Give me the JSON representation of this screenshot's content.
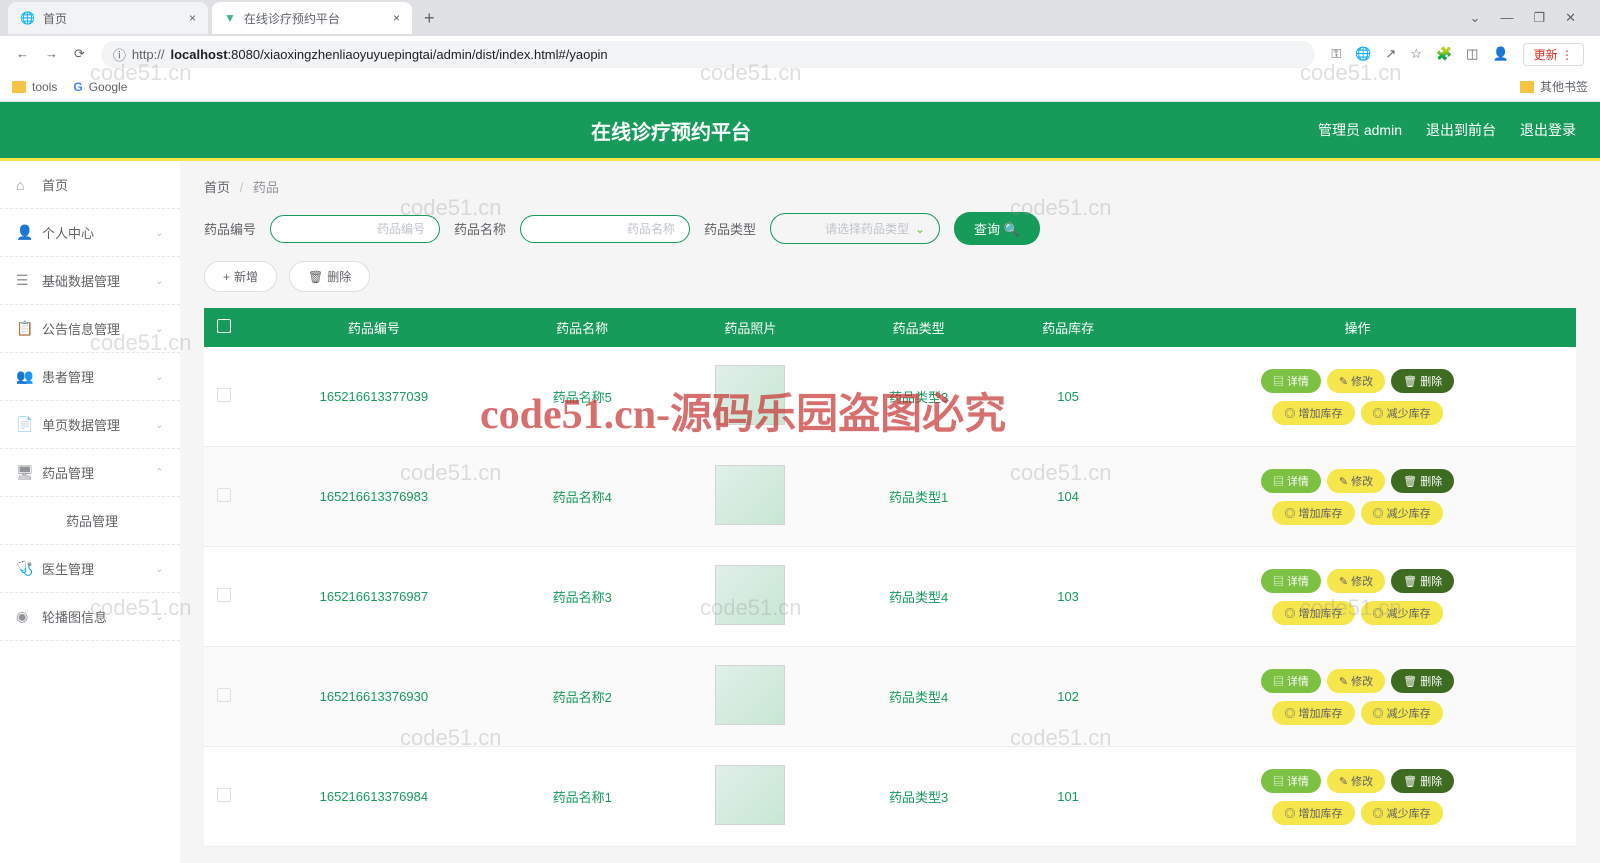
{
  "browser": {
    "tabs": [
      {
        "label": "首页"
      },
      {
        "label": "在线诊疗预约平台"
      }
    ],
    "url_prefix": "http://",
    "url_host": "localhost",
    "url_rest": ":8080/xiaoxingzhenliaoyuyuepingtai/admin/dist/index.html#/yaopin",
    "update_label": "更新",
    "bookmarks": [
      {
        "label": "tools"
      },
      {
        "label": "Google"
      }
    ],
    "other_bookmarks": "其他书签"
  },
  "header": {
    "title": "在线诊疗预约平台",
    "admin": "管理员 admin",
    "logout_front": "退出到前台",
    "logout": "退出登录"
  },
  "sidebar": {
    "items": [
      {
        "icon": "⌂",
        "label": "首页",
        "expandable": false
      },
      {
        "icon": "👤",
        "label": "个人中心",
        "expandable": true,
        "arrow": "⌄"
      },
      {
        "icon": "☰",
        "label": "基础数据管理",
        "expandable": true,
        "arrow": "⌄"
      },
      {
        "icon": "📋",
        "label": "公告信息管理",
        "expandable": true,
        "arrow": "⌄"
      },
      {
        "icon": "👥",
        "label": "患者管理",
        "expandable": true,
        "arrow": "⌄"
      },
      {
        "icon": "📄",
        "label": "单页数据管理",
        "expandable": true,
        "arrow": "⌄"
      },
      {
        "icon": "🖥",
        "label": "药品管理",
        "expandable": true,
        "arrow": "⌃"
      },
      {
        "icon": "",
        "label": "药品管理",
        "expandable": false,
        "sub": true
      },
      {
        "icon": "🩺",
        "label": "医生管理",
        "expandable": true,
        "arrow": "⌄"
      },
      {
        "icon": "◉",
        "label": "轮播图信息",
        "expandable": true,
        "arrow": "⌄"
      }
    ]
  },
  "breadcrumb": {
    "home": "首页",
    "current": "药品"
  },
  "filters": {
    "id_label": "药品编号",
    "id_placeholder": "药品编号",
    "name_label": "药品名称",
    "name_placeholder": "药品名称",
    "type_label": "药品类型",
    "type_placeholder": "请选择药品类型",
    "query": "查询"
  },
  "actions": {
    "add": "新增",
    "delete": "删除"
  },
  "table": {
    "headers": [
      "药品编号",
      "药品名称",
      "药品照片",
      "药品类型",
      "药品库存",
      "操作"
    ],
    "rows": [
      {
        "id": "165216613377039",
        "name": "药品名称5",
        "type": "药品类型3",
        "stock": "105"
      },
      {
        "id": "165216613376983",
        "name": "药品名称4",
        "type": "药品类型1",
        "stock": "104"
      },
      {
        "id": "165216613376987",
        "name": "药品名称3",
        "type": "药品类型4",
        "stock": "103"
      },
      {
        "id": "165216613376930",
        "name": "药品名称2",
        "type": "药品类型4",
        "stock": "102"
      },
      {
        "id": "165216613376984",
        "name": "药品名称1",
        "type": "药品类型3",
        "stock": "101"
      }
    ],
    "ops": {
      "detail": "详情",
      "edit": "修改",
      "delete": "删除",
      "inc": "增加库存",
      "dec": "减少库存"
    }
  },
  "watermark": {
    "main": "code51.cn-源码乐园盗图必究",
    "small": "code51.cn"
  }
}
